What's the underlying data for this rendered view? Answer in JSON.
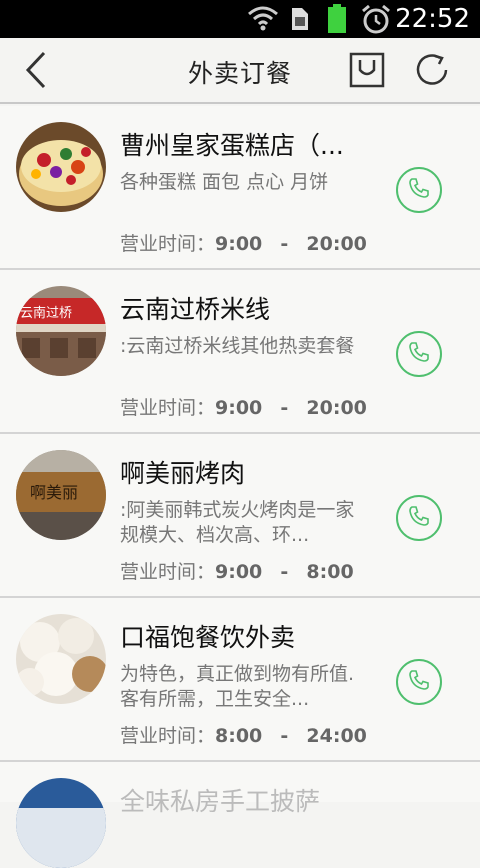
{
  "status_bar": {
    "time": "22:52",
    "icons": [
      "wifi-icon",
      "sim-icon",
      "battery-icon",
      "alarm-icon"
    ]
  },
  "header": {
    "title": "外卖订餐",
    "back_icon": "back-arrow-icon",
    "cart_icon": "cart-icon",
    "refresh_icon": "refresh-icon"
  },
  "restaurants": [
    {
      "name": "曹州皇家蛋糕店（...",
      "desc": "各种蛋糕 面包 点心 月饼",
      "hours_label": "营业时间：",
      "open": "9:00",
      "sep": "-",
      "close": "20:00"
    },
    {
      "name": "云南过桥米线",
      "desc": ":云南过桥米线其他热卖套餐",
      "hours_label": "营业时间：",
      "open": "9:00",
      "sep": "-",
      "close": "20:00"
    },
    {
      "name": "啊美丽烤肉",
      "desc": ":阿美丽韩式炭火烤肉是一家规模大、档次高、环...",
      "hours_label": "营业时间：",
      "open": "9:00",
      "sep": "-",
      "close": "8:00"
    },
    {
      "name": "口福饱餐饮外卖",
      "desc": "为特色，真正做到物有所值.客有所需，卫生安全...",
      "hours_label": "营业时间：",
      "open": "8:00",
      "sep": "-",
      "close": "24:00"
    },
    {
      "name": "全味私房手工披萨"
    }
  ],
  "colors": {
    "accent_green": "#4fbf6e",
    "background": "#f4f4f2",
    "divider": "#d4d4d4"
  }
}
